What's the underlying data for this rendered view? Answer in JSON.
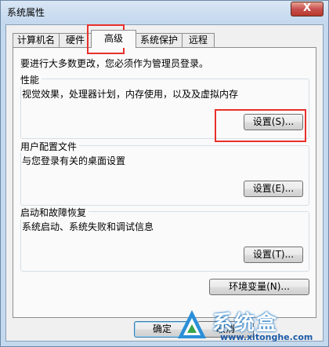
{
  "window": {
    "title": "系统属性",
    "close_glyph": "X"
  },
  "tabs": [
    {
      "label": "计算机名"
    },
    {
      "label": "硬件"
    },
    {
      "label": "高级"
    },
    {
      "label": "系统保护"
    },
    {
      "label": "远程"
    }
  ],
  "active_tab": "高级",
  "admin_note": "要进行大多数更改，您必须作为管理员登录。",
  "groups": {
    "performance": {
      "title": "性能",
      "description": "视觉效果，处理器计划，内存使用，以及及虚拟内存",
      "button": "设置(S)..."
    },
    "user_profiles": {
      "title": "用户配置文件",
      "description": "与您登录有关的桌面设置",
      "button": "设置(E)..."
    },
    "startup_recovery": {
      "title": "启动和故障恢复",
      "description": "系统启动、系统失败和调试信息",
      "button": "设置(T)..."
    }
  },
  "env_button": "环境变量(N)...",
  "footer": {
    "ok_button": "确定",
    "cancel_button": "取消"
  },
  "watermark": {
    "name": "系统盒",
    "url": "www.xitonghe.com"
  },
  "colors": {
    "highlight": "#e8302c",
    "accent": "#3c7fb1"
  }
}
